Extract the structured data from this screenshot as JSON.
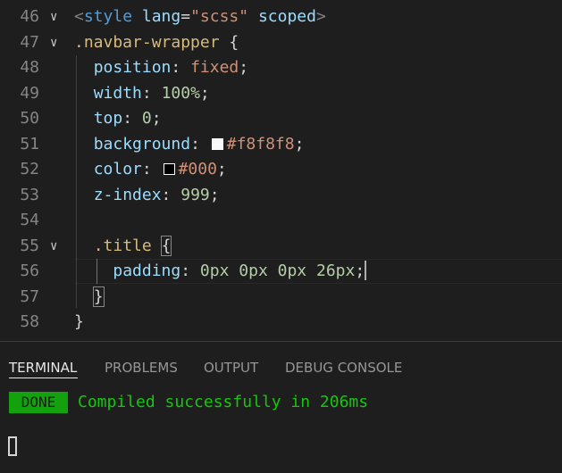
{
  "editor": {
    "lines": [
      {
        "n": "46",
        "tokens": [
          [
            "tag-bracket",
            "<"
          ],
          [
            "tag",
            "style"
          ],
          [
            "punc",
            " "
          ],
          [
            "attr",
            "lang"
          ],
          [
            "punc",
            "="
          ],
          [
            "str",
            "\"scss\""
          ],
          [
            "punc",
            " "
          ],
          [
            "attr",
            "scoped"
          ],
          [
            "tag-bracket",
            ">"
          ]
        ]
      },
      {
        "n": "47",
        "tokens": [
          [
            "sel",
            ".navbar-wrapper"
          ],
          [
            "punc",
            " {"
          ]
        ]
      },
      {
        "n": "48",
        "tokens": [
          [
            "punc",
            "  "
          ],
          [
            "prop",
            "position"
          ],
          [
            "punc",
            ": "
          ],
          [
            "val",
            "fixed"
          ],
          [
            "punc",
            ";"
          ]
        ]
      },
      {
        "n": "49",
        "tokens": [
          [
            "punc",
            "  "
          ],
          [
            "prop",
            "width"
          ],
          [
            "punc",
            ": "
          ],
          [
            "num",
            "100%"
          ],
          [
            "punc",
            ";"
          ]
        ]
      },
      {
        "n": "50",
        "tokens": [
          [
            "punc",
            "  "
          ],
          [
            "prop",
            "top"
          ],
          [
            "punc",
            ": "
          ],
          [
            "num",
            "0"
          ],
          [
            "punc",
            ";"
          ]
        ]
      },
      {
        "n": "51",
        "tokens": [
          [
            "punc",
            "  "
          ],
          [
            "prop",
            "background"
          ],
          [
            "punc",
            ": "
          ],
          [
            "swatch",
            "#f8f8f8"
          ],
          [
            "val",
            "#f8f8f8"
          ],
          [
            "punc",
            ";"
          ]
        ]
      },
      {
        "n": "52",
        "tokens": [
          [
            "punc",
            "  "
          ],
          [
            "prop",
            "color"
          ],
          [
            "punc",
            ": "
          ],
          [
            "swatch",
            "#000000"
          ],
          [
            "val",
            "#000"
          ],
          [
            "punc",
            ";"
          ]
        ]
      },
      {
        "n": "53",
        "tokens": [
          [
            "punc",
            "  "
          ],
          [
            "prop",
            "z-index"
          ],
          [
            "punc",
            ": "
          ],
          [
            "num",
            "999"
          ],
          [
            "punc",
            ";"
          ]
        ]
      },
      {
        "n": "54",
        "tokens": []
      },
      {
        "n": "55",
        "tokens": [
          [
            "punc",
            "  "
          ],
          [
            "sel",
            ".title"
          ],
          [
            "punc",
            " "
          ],
          [
            "brace",
            "{"
          ]
        ]
      },
      {
        "n": "56",
        "tokens": [
          [
            "punc",
            "    "
          ],
          [
            "prop",
            "padding"
          ],
          [
            "punc",
            ": "
          ],
          [
            "num",
            "0px"
          ],
          [
            "punc",
            " "
          ],
          [
            "num",
            "0px"
          ],
          [
            "punc",
            " "
          ],
          [
            "num",
            "0px"
          ],
          [
            "punc",
            " "
          ],
          [
            "num",
            "26px"
          ],
          [
            "punc",
            ";"
          ],
          [
            "cursor",
            ""
          ]
        ]
      },
      {
        "n": "57",
        "tokens": [
          [
            "punc",
            "  "
          ],
          [
            "brace",
            "}"
          ]
        ]
      },
      {
        "n": "58",
        "tokens": [
          [
            "punc",
            "}"
          ]
        ]
      }
    ],
    "fold_lines": [
      "46",
      "47",
      "55"
    ]
  },
  "panel": {
    "tabs": [
      "TERMINAL",
      "PROBLEMS",
      "OUTPUT",
      "DEBUG CONSOLE"
    ],
    "active_tab": "TERMINAL",
    "badge": "DONE",
    "message": "Compiled successfully in 206ms"
  }
}
